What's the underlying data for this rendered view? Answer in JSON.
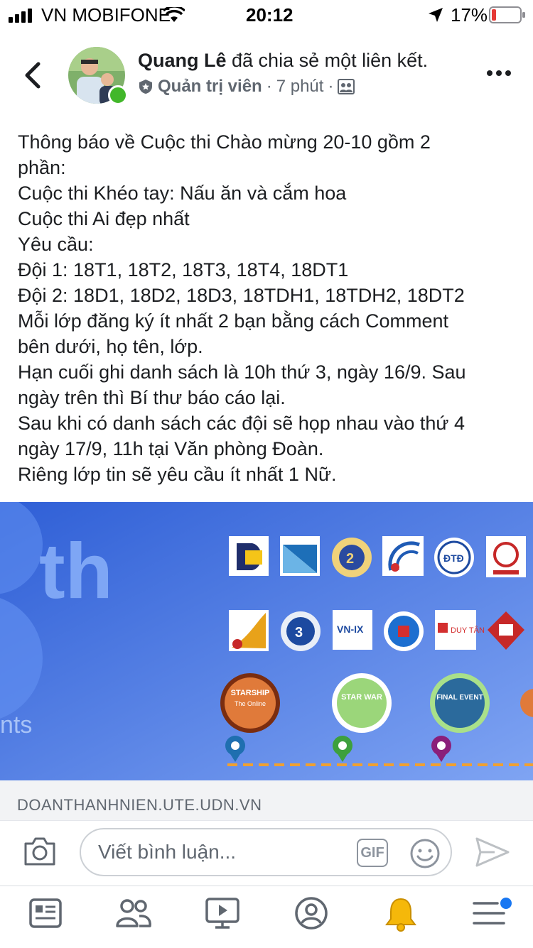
{
  "status_bar": {
    "carrier": "VN MOBIFONE",
    "time": "20:12",
    "battery_percent": "17%",
    "battery_level": 0.17,
    "icons": [
      "signal-icon",
      "wifi-icon",
      "location-arrow-icon",
      "battery-icon"
    ]
  },
  "post": {
    "author": "Quang Lê",
    "action": " đã chia sẻ một liên kết.",
    "role": "Quản trị viên",
    "separator": "·",
    "time_ago": "7 phút",
    "lines": [
      "Thông báo về Cuộc thi Chào mừng 20-10 gồm 2",
      "phần:",
      "Cuộc thi Khéo tay: Nấu ăn và cắm hoa",
      "Cuộc thi Ai đẹp nhất",
      "Yêu cầu:",
      "Đội 1: 18T1, 18T2, 18T3, 18T4, 18DT1",
      "Đội 2: 18D1, 18D2, 18D3, 18TDH1, 18TDH2, 18DT2",
      "Mỗi lớp đăng ký ít nhất 2 bạn bằng cách Comment",
      "bên dưới, họ tên, lớp.",
      "Hạn cuối ghi danh sách là 10h thứ 3, ngày 16/9. Sau",
      "ngày trên thì Bí thư báo cáo lại.",
      "Sau khi có danh sách các đội sẽ họp nhau vào thứ 4",
      "ngày 17/9, 11h tại Văn phòng Đoàn.",
      "Riêng lớp tin sẽ yêu cầu ít nhất 1 Nữ."
    ]
  },
  "link": {
    "domain": "DOANTHANHNIEN.UTE.UDN.VN",
    "image_text": "th",
    "image_side_text": "nts",
    "badges": [
      {
        "top": "STARSHIP",
        "mid": "The Online"
      },
      {
        "top": "STAR WAR",
        "mid": ""
      },
      {
        "top": "FINAL EVENT",
        "mid": ""
      }
    ]
  },
  "comment_bar": {
    "placeholder": "Viết bình luận...",
    "gif_label": "GIF"
  },
  "colors": {
    "accent": "#1877f2",
    "online": "#42b72a",
    "battery_low": "#e53935"
  }
}
